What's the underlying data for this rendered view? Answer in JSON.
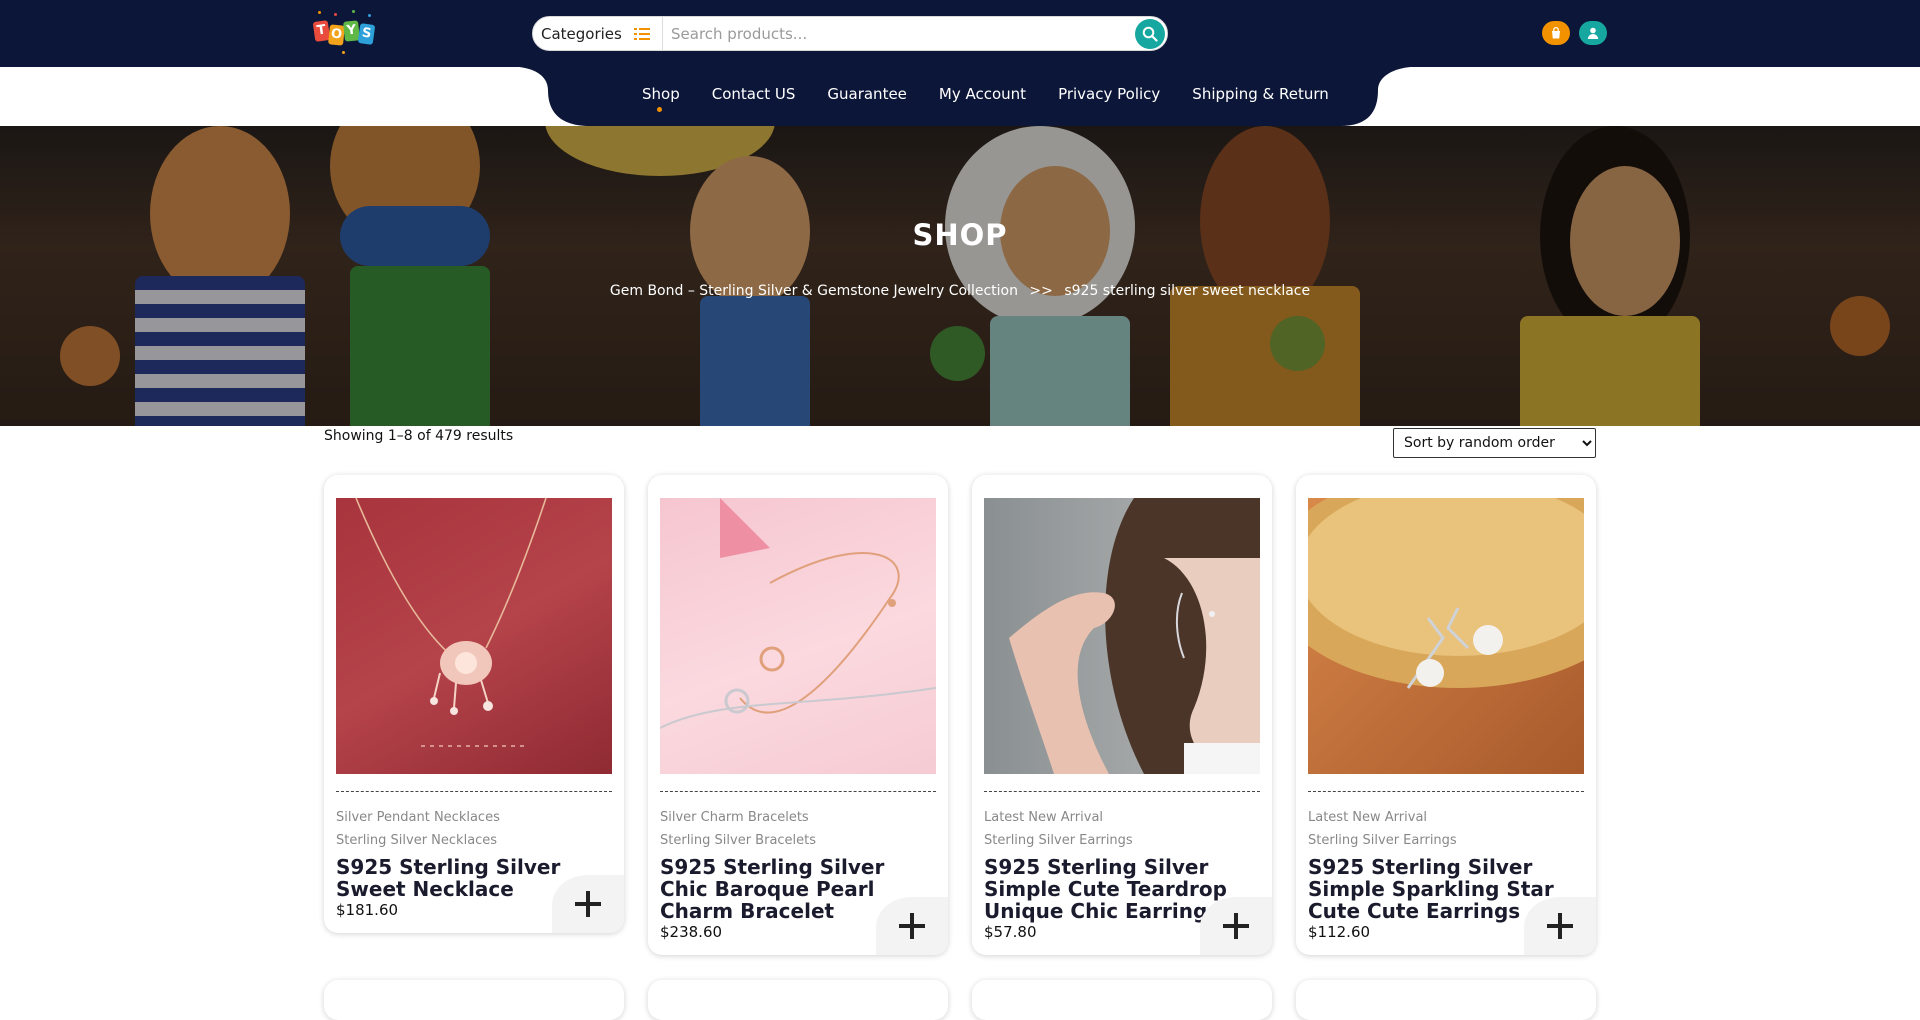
{
  "header": {
    "logo_text": "TOYS",
    "categories_label": "Categories",
    "search_placeholder": "Search products..."
  },
  "nav": {
    "items": [
      {
        "label": "Shop",
        "active": true
      },
      {
        "label": "Contact US"
      },
      {
        "label": "Guarantee"
      },
      {
        "label": "My Account"
      },
      {
        "label": "Privacy Policy"
      },
      {
        "label": "Shipping & Return"
      }
    ]
  },
  "hero": {
    "title": "SHOP",
    "breadcrumb_home": "Gem Bond – Sterling Silver & Gemstone Jewelry Collection",
    "breadcrumb_sep": ">>",
    "breadcrumb_current": "s925 sterling silver sweet necklace"
  },
  "shop": {
    "results_text": "Showing 1–8 of 479 results",
    "sort_selected": "Sort by random order"
  },
  "products": [
    {
      "cat1": "Silver Pendant Necklaces",
      "cat2": "Sterling Silver Necklaces",
      "title": "S925 Sterling Silver Sweet Necklace",
      "price": "$181.60"
    },
    {
      "cat1": "Silver Charm Bracelets",
      "cat2": "Sterling Silver Bracelets",
      "title": "S925 Sterling Silver Chic Baroque Pearl Charm Bracelet",
      "price": "$238.60"
    },
    {
      "cat1": "Latest New Arrival",
      "cat2": "Sterling Silver Earrings",
      "title": "S925 Sterling Silver Simple Cute Teardrop Unique Chic Earrings",
      "price": "$57.80"
    },
    {
      "cat1": "Latest New Arrival",
      "cat2": "Sterling Silver Earrings",
      "title": "S925 Sterling Silver Simple Sparkling Star Cute Cute Earrings",
      "price": "$112.60"
    }
  ],
  "colors": {
    "header_bg": "#0c1638",
    "accent_orange": "#f39200",
    "accent_teal": "#16a8a0"
  },
  "icons": {
    "categories": "list-icon",
    "search": "search-icon",
    "cart": "shopping-bag-icon",
    "account": "user-icon",
    "add": "plus-icon"
  }
}
